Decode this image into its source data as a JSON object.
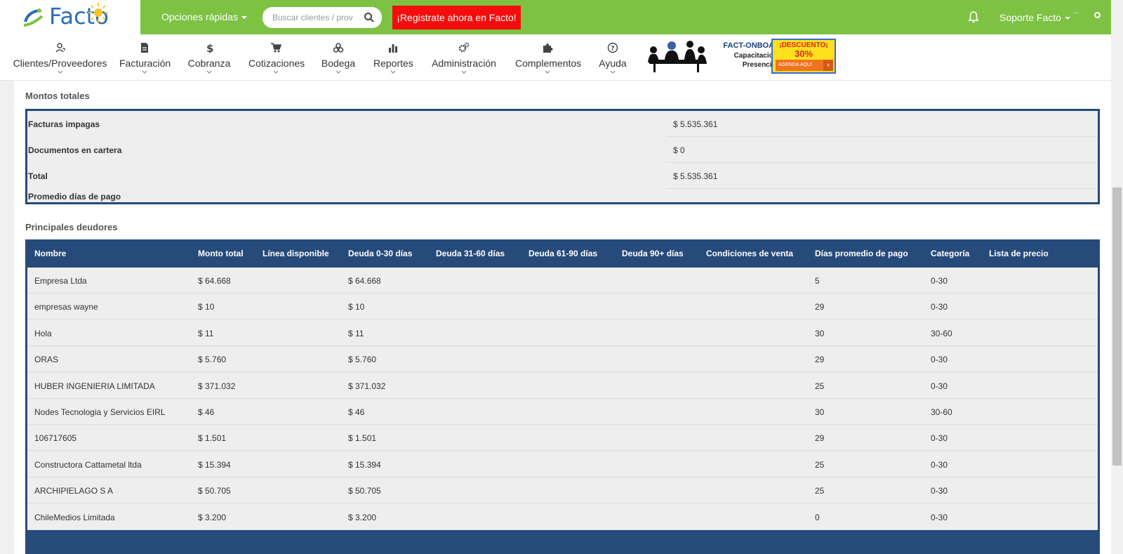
{
  "header": {
    "logo_text": "Facto",
    "quick_options": "Opciones rápidas",
    "search_placeholder": "Buscar clientes / prov",
    "register_cta": "¡Registrate ahora en Facto!",
    "user_menu": "Soporte Facto",
    "avatar_alt": "...",
    "colors": {
      "brand_green": "#7dc243",
      "cta_red": "#f40d0d"
    }
  },
  "nav": {
    "items": [
      {
        "label": "Clientes/Proveedores",
        "icon": "users-icon"
      },
      {
        "label": "Facturación",
        "icon": "document-icon"
      },
      {
        "label": "Cobranza",
        "icon": "dollar-icon"
      },
      {
        "label": "Cotizaciones",
        "icon": "cart-icon"
      },
      {
        "label": "Bodega",
        "icon": "boxes-icon"
      },
      {
        "label": "Reportes",
        "icon": "bar-chart-icon"
      },
      {
        "label": "Administración",
        "icon": "gears-icon"
      },
      {
        "label": "Complementos",
        "icon": "puzzle-icon"
      },
      {
        "label": "Ayuda",
        "icon": "help-icon"
      }
    ]
  },
  "banner": {
    "title": "FACT-ONBOARD",
    "subtitle_1": "Capacitaciones",
    "subtitle_2": "Presenciales",
    "discount": "¡DESCUENTO¡",
    "percent": "30%",
    "button": "AGENDA AQUÍ"
  },
  "totals": {
    "title": "Montos totales",
    "rows": [
      {
        "label": "Facturas impagas",
        "value": "$ 5.535.361"
      },
      {
        "label": "Documentos en cartera",
        "value": "$ 0"
      },
      {
        "label": "Total",
        "value": "$ 5.535.361"
      },
      {
        "label": "Promedio días de pago",
        "value": ""
      }
    ]
  },
  "debtors": {
    "title": "Principales deudores",
    "columns": [
      "Nombre",
      "Monto total",
      "Línea disponible",
      "Deuda 0-30 días",
      "Deuda 31-60 días",
      "Deuda 61-90 días",
      "Deuda 90+ días",
      "Condiciones de venta",
      "Días promedio de pago",
      "Categoría",
      "Lista de precio"
    ],
    "rows": [
      {
        "nombre": "Empresa Ltda",
        "monto": "$ 64.668",
        "linea": "",
        "d030": "$ 64.668",
        "d3160": "",
        "d6190": "",
        "d90": "",
        "cond": "",
        "dias": "5",
        "cat": "0-30",
        "lista": ""
      },
      {
        "nombre": "empresas wayne",
        "monto": "$ 10",
        "linea": "",
        "d030": "$ 10",
        "d3160": "",
        "d6190": "",
        "d90": "",
        "cond": "",
        "dias": "29",
        "cat": "0-30",
        "lista": ""
      },
      {
        "nombre": "Hola",
        "monto": "$ 11",
        "linea": "",
        "d030": "$ 11",
        "d3160": "",
        "d6190": "",
        "d90": "",
        "cond": "",
        "dias": "30",
        "cat": "30-60",
        "lista": ""
      },
      {
        "nombre": "ORAS",
        "monto": "$ 5.760",
        "linea": "",
        "d030": "$ 5.760",
        "d3160": "",
        "d6190": "",
        "d90": "",
        "cond": "",
        "dias": "29",
        "cat": "0-30",
        "lista": ""
      },
      {
        "nombre": "HUBER INGENIERIA LIMITADA",
        "monto": "$ 371.032",
        "linea": "",
        "d030": "$ 371.032",
        "d3160": "",
        "d6190": "",
        "d90": "",
        "cond": "",
        "dias": "25",
        "cat": "0-30",
        "lista": ""
      },
      {
        "nombre": "Nodes Tecnologia y Servicios EIRL",
        "monto": "$ 46",
        "linea": "",
        "d030": "$ 46",
        "d3160": "",
        "d6190": "",
        "d90": "",
        "cond": "",
        "dias": "30",
        "cat": "30-60",
        "lista": ""
      },
      {
        "nombre": "106717605",
        "monto": "$ 1.501",
        "linea": "",
        "d030": "$ 1.501",
        "d3160": "",
        "d6190": "",
        "d90": "",
        "cond": "",
        "dias": "29",
        "cat": "0-30",
        "lista": ""
      },
      {
        "nombre": "Constructora Cattametal ltda",
        "monto": "$ 15.394",
        "linea": "",
        "d030": "$ 15.394",
        "d3160": "",
        "d6190": "",
        "d90": "",
        "cond": "",
        "dias": "25",
        "cat": "0-30",
        "lista": ""
      },
      {
        "nombre": "ARCHIPIELAGO S A",
        "monto": "$ 50.705",
        "linea": "",
        "d030": "$ 50.705",
        "d3160": "",
        "d6190": "",
        "d90": "",
        "cond": "",
        "dias": "25",
        "cat": "0-30",
        "lista": ""
      },
      {
        "nombre": "ChileMedios Limitada",
        "monto": "$ 3.200",
        "linea": "",
        "d030": "$ 3.200",
        "d3160": "",
        "d6190": "",
        "d90": "",
        "cond": "",
        "dias": "0",
        "cat": "0-30",
        "lista": ""
      }
    ]
  }
}
